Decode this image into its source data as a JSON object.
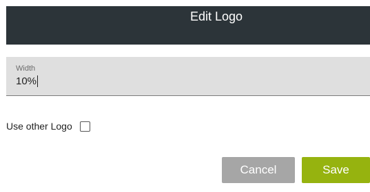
{
  "dialog": {
    "title": "Edit Logo"
  },
  "width_field": {
    "label": "Width",
    "value": "10%"
  },
  "use_other_logo": {
    "label": "Use other Logo",
    "checked": false
  },
  "actions": {
    "cancel_label": "Cancel",
    "save_label": "Save"
  },
  "colors": {
    "header_bg": "#2c3439",
    "save_bg": "#96b30f",
    "cancel_bg": "#a6a6a6",
    "field_bg": "#dfdfdf"
  }
}
